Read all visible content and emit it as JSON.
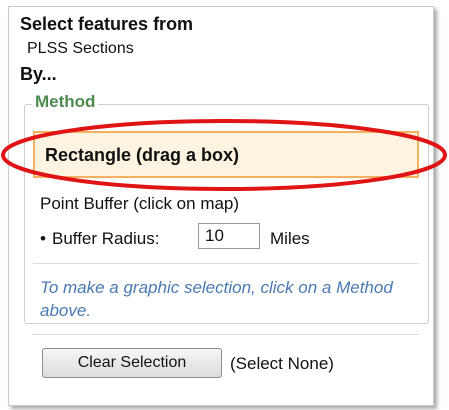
{
  "panel": {
    "heading": "Select features from",
    "layer_name": "PLSS Sections",
    "by_label": "By...",
    "method_legend": "Method",
    "methods": {
      "rectangle": "Rectangle (drag a box)",
      "point_buffer": "Point Buffer (click on map)"
    },
    "buffer": {
      "bullet": "•",
      "label": "Buffer Radius:",
      "value": "10",
      "units": "Miles"
    },
    "instructions": "To make a graphic selection, click on a Method above.",
    "clear_button": "Clear Selection",
    "select_none": "(Select None)"
  },
  "colors": {
    "legend_green": "#4d8a50",
    "selected_fill": "#fcf4e1",
    "selected_border": "#f2b15e",
    "annotation_red": "#e01414",
    "instructions_blue": "#4a79b3"
  }
}
